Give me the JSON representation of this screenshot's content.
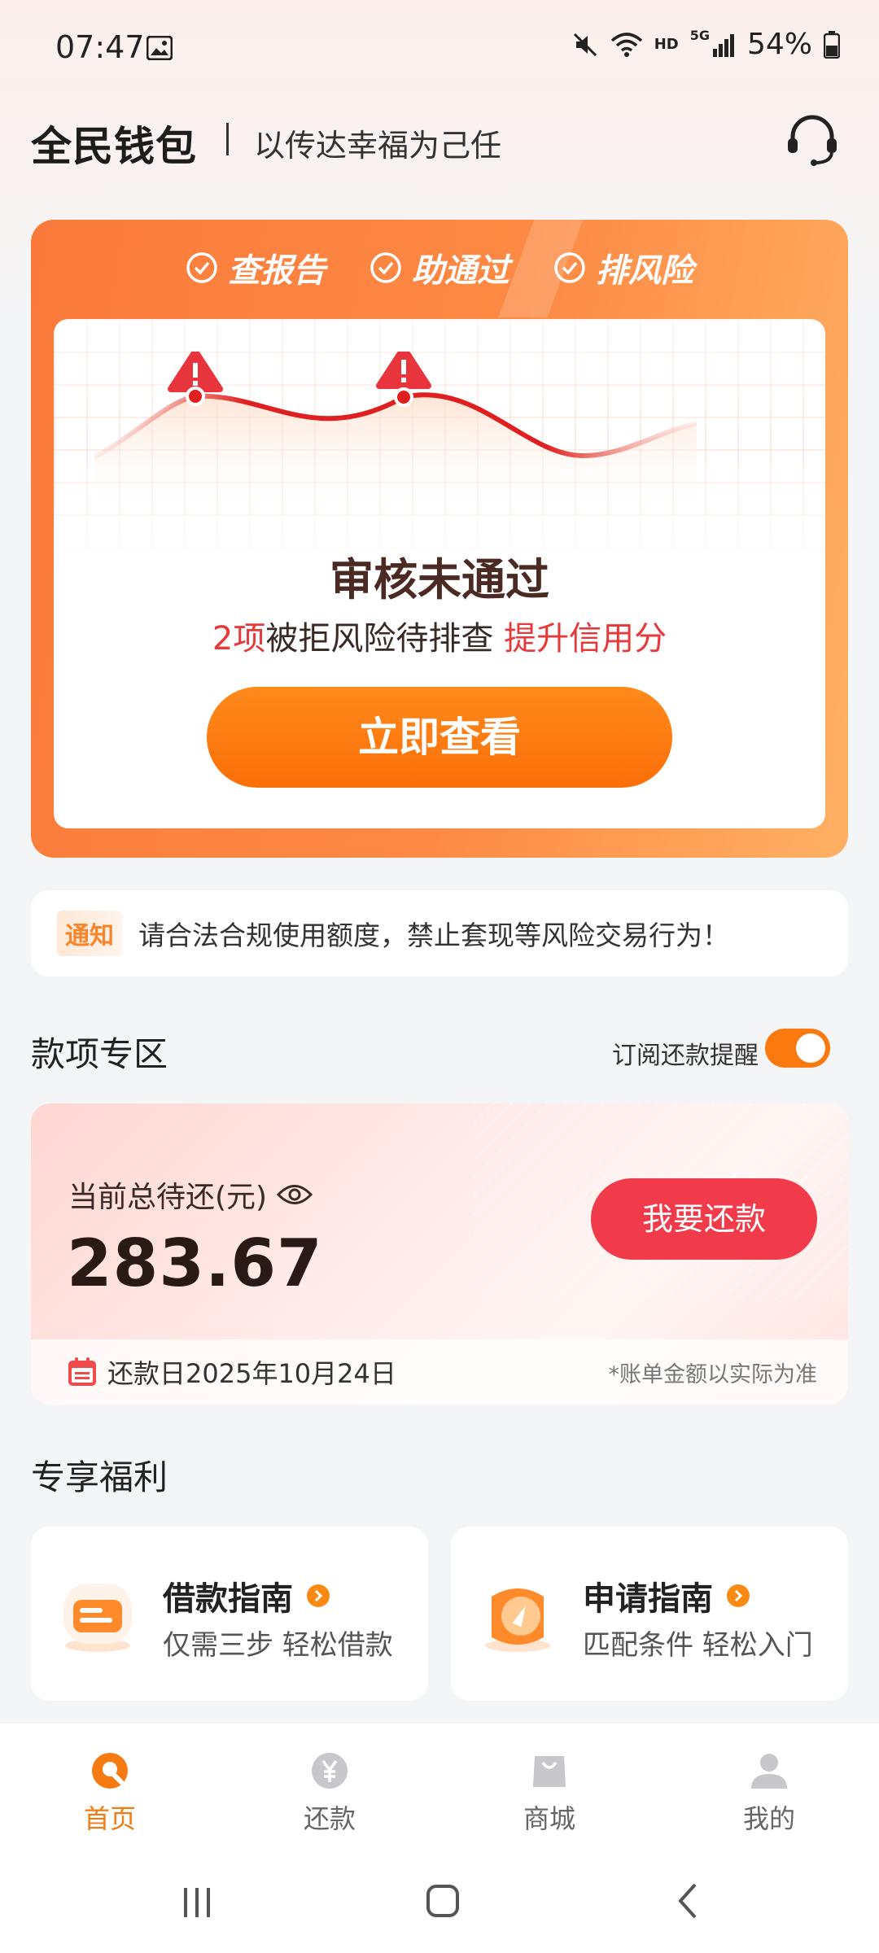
{
  "status_bar": {
    "time": "07:47",
    "battery": "54%",
    "net_hd": "HD",
    "net_5g": "5G"
  },
  "header": {
    "brand": "全民钱包",
    "slogan": "以传达幸福为己任"
  },
  "risk_card": {
    "tags": [
      "查报告",
      "助通过",
      "排风险"
    ],
    "title": "审核未通过",
    "sub_count": "2项",
    "sub_text": "被拒风险待排查",
    "sub_link": "提升信用分",
    "button": "立即查看"
  },
  "notice": {
    "badge": "通知",
    "text": "请合法合规使用额度，禁止套现等风险交易行为！"
  },
  "repay_section": {
    "title": "款项专区",
    "subscribe_label": "订阅还款提醒",
    "subscribe_on": true,
    "total_label": "当前总待还(元)",
    "amount": "283.67",
    "button": "我要还款",
    "due_date": "还款日2025年10月24日",
    "note": "*账单金额以实际为准"
  },
  "benefits": {
    "title": "专享福利",
    "cards": [
      {
        "title": "借款指南",
        "sub": "仅需三步 轻松借款"
      },
      {
        "title": "申请指南",
        "sub": "匹配条件 轻松入门"
      }
    ]
  },
  "bottom_nav": [
    {
      "label": "首页",
      "icon": "home-icon",
      "active": true
    },
    {
      "label": "还款",
      "icon": "yen-icon",
      "active": false
    },
    {
      "label": "商城",
      "icon": "shopping-bag-icon",
      "active": false
    },
    {
      "label": "我的",
      "icon": "user-icon",
      "active": false
    }
  ],
  "colors": {
    "accent": "#fb7a10",
    "danger": "#f23b4a",
    "active_nav": "#f57a12"
  }
}
